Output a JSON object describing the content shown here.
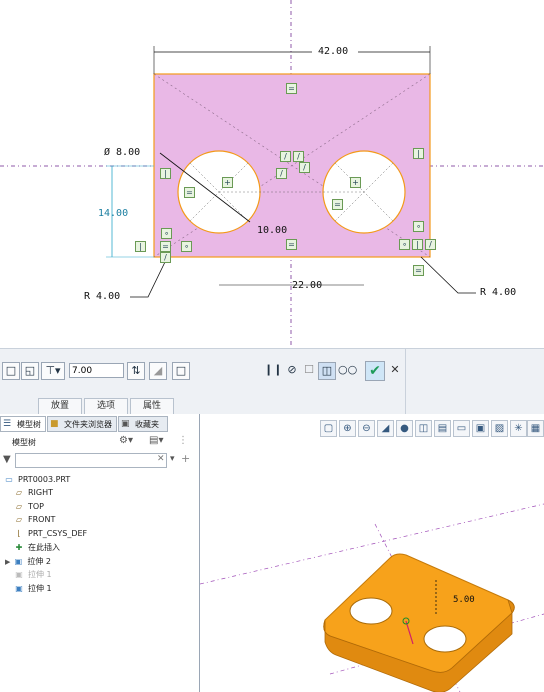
{
  "sketch": {
    "dim_width": "42.00",
    "dim_diameter": "Ø  8.00",
    "dim_height": "14.00",
    "dim_center": "10.00",
    "dim_spacing": "22.00",
    "dim_radius_left": "R 4.00",
    "dim_radius_right": "R 4.00"
  },
  "dashboard": {
    "depth_value": "7.00",
    "tabs": [
      "放置",
      "选项",
      "属性"
    ]
  },
  "panel": {
    "tabs": [
      "模型树",
      "文件夹浏览器",
      "收藏夹"
    ],
    "header": "模型树",
    "search_placeholder": "",
    "tree": [
      {
        "icon": "part-icon",
        "label": "PRT0003.PRT"
      },
      {
        "icon": "datum-plane-icon",
        "label": "RIGHT"
      },
      {
        "icon": "datum-plane-icon",
        "label": "TOP"
      },
      {
        "icon": "datum-plane-icon",
        "label": "FRONT"
      },
      {
        "icon": "csys-icon",
        "label": "PRT_CSYS_DEF"
      },
      {
        "icon": "insert-here-icon",
        "label": "在此插入"
      },
      {
        "icon": "extrude-icon",
        "label": "拉伸 2"
      },
      {
        "icon": "extrude-icon",
        "label": "拉伸 1"
      },
      {
        "icon": "extrude-icon",
        "label": "拉伸 1"
      }
    ]
  },
  "view3d": {
    "dim_label": "5.00"
  },
  "colors": {
    "sketch_fill": "#e9b8e6",
    "sketch_edge": "#f39a1a",
    "model_orange": "#f7a21b",
    "accept_green": "#1e9c5a"
  }
}
